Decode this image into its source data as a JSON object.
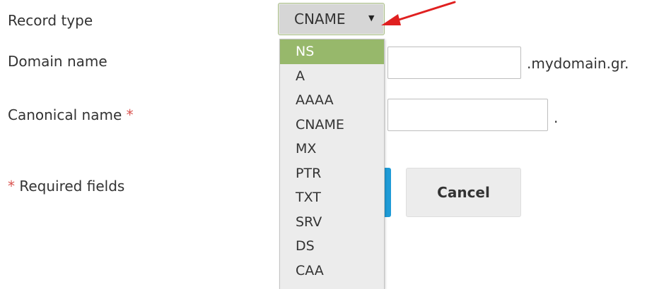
{
  "form": {
    "record_type": {
      "label": "Record type",
      "value": "CNAME",
      "caret": "▼"
    },
    "domain_name": {
      "label": "Domain name",
      "value": "",
      "suffix": ".mydomain.gr."
    },
    "canonical_name": {
      "label": "Canonical name",
      "required_marker": "*",
      "value": "",
      "suffix": "."
    },
    "required_note": {
      "marker": "*",
      "text": "Required fields"
    }
  },
  "buttons": {
    "cancel_label": "Cancel"
  },
  "dropdown": {
    "highlighted": "NS",
    "options": [
      "NS",
      "A",
      "AAAA",
      "CNAME",
      "MX",
      "PTR",
      "TXT",
      "SRV",
      "DS",
      "CAA"
    ]
  },
  "annotation": {
    "arrow_color": "#e02020"
  },
  "colors": {
    "highlight": "#97b86b",
    "required": "#d9534f",
    "primary_button": "#1e9bd7"
  }
}
